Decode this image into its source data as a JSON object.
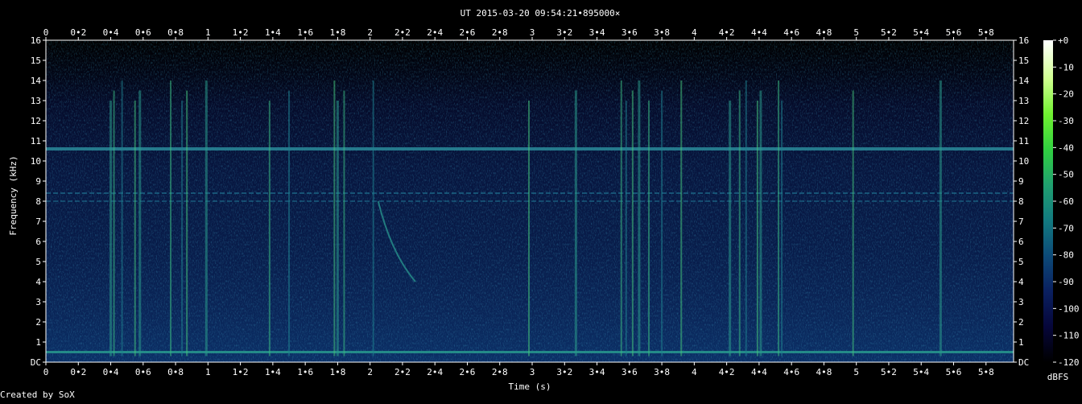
{
  "chart_data": {
    "type": "heatmap",
    "title": "UT 2015-03-20 09:54:21•895000×",
    "xlabel": "Time (s)",
    "ylabel": "Frequency (kHz)",
    "xlim": [
      0,
      5.97
    ],
    "ylim": [
      0,
      16
    ],
    "x_ticks": [
      "0",
      "0•2",
      "0•4",
      "0•6",
      "0•8",
      "1",
      "1•2",
      "1•4",
      "1•6",
      "1•8",
      "2",
      "2•2",
      "2•4",
      "2•6",
      "2•8",
      "3",
      "3•2",
      "3•4",
      "3•6",
      "3•8",
      "4",
      "4•2",
      "4•4",
      "4•6",
      "4•8",
      "5",
      "5•2",
      "5•4",
      "5•6",
      "5•8"
    ],
    "x_tick_values": [
      0,
      0.2,
      0.4,
      0.6,
      0.8,
      1,
      1.2,
      1.4,
      1.6,
      1.8,
      2,
      2.2,
      2.4,
      2.6,
      2.8,
      3,
      3.2,
      3.4,
      3.6,
      3.8,
      4,
      4.2,
      4.4,
      4.6,
      4.8,
      5,
      5.2,
      5.4,
      5.6,
      5.8
    ],
    "y_ticks": [
      "DC",
      "1",
      "2",
      "3",
      "4",
      "5",
      "6",
      "7",
      "8",
      "9",
      "10",
      "11",
      "12",
      "13",
      "14",
      "15",
      "16"
    ],
    "y_tick_values": [
      0,
      1,
      2,
      3,
      4,
      5,
      6,
      7,
      8,
      9,
      10,
      11,
      12,
      13,
      14,
      15,
      16
    ],
    "colorbar": {
      "label": "dBFS",
      "ticks": [
        "+0",
        "-10",
        "-20",
        "-30",
        "-40",
        "-50",
        "-60",
        "-70",
        "-80",
        "-90",
        "-100",
        "-110",
        "-120"
      ],
      "tick_values": [
        0,
        -10,
        -20,
        -30,
        -40,
        -50,
        -60,
        -70,
        -80,
        -90,
        -100,
        -110,
        -120
      ],
      "range": [
        -120,
        0
      ],
      "colors": [
        "#000000",
        "#06063a",
        "#0a2060",
        "#0c4a78",
        "#127a80",
        "#20a070",
        "#30d040",
        "#70f030",
        "#d0ff90",
        "#ffffff"
      ]
    },
    "features": {
      "horizontal_bands_khz": [
        10.6,
        8.4,
        8.0,
        0.5
      ],
      "vertical_bursts_s": [
        0.4,
        0.42,
        0.47,
        0.55,
        0.58,
        0.77,
        0.84,
        0.87,
        0.99,
        1.38,
        1.5,
        1.78,
        1.8,
        1.84,
        2.02,
        2.98,
        3.27,
        3.55,
        3.58,
        3.62,
        3.66,
        3.72,
        3.8,
        3.92,
        4.22,
        4.28,
        4.32,
        4.39,
        4.41,
        4.52,
        4.54,
        4.98,
        5.52
      ],
      "chirp": {
        "start_s": 2.05,
        "end_s": 2.28,
        "start_khz": 8.0,
        "end_khz": 4.0
      }
    }
  },
  "footer": {
    "credit": "Created by SoX"
  }
}
